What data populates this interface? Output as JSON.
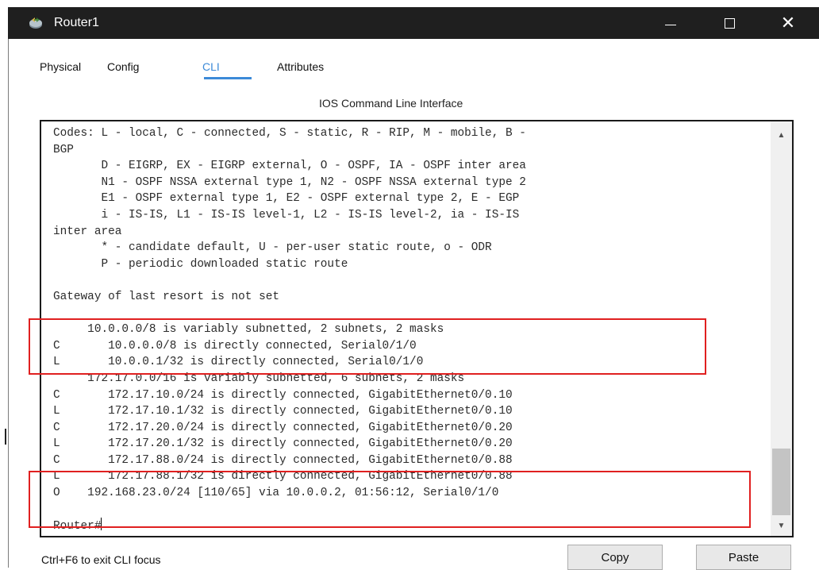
{
  "window": {
    "title": "Router1",
    "icon": "router-icon",
    "controls": {
      "minimize": "minimize-icon",
      "maximize": "maximize-icon",
      "close": "✕"
    }
  },
  "tabs": [
    {
      "label": "Physical",
      "active": false
    },
    {
      "label": "Config",
      "active": false
    },
    {
      "label": "CLI",
      "active": true
    },
    {
      "label": "Attributes",
      "active": false
    }
  ],
  "section_title": "IOS Command Line Interface",
  "terminal": {
    "lines": [
      "Codes: L - local, C - connected, S - static, R - RIP, M - mobile, B -",
      "BGP",
      "       D - EIGRP, EX - EIGRP external, O - OSPF, IA - OSPF inter area",
      "       N1 - OSPF NSSA external type 1, N2 - OSPF NSSA external type 2",
      "       E1 - OSPF external type 1, E2 - OSPF external type 2, E - EGP",
      "       i - IS-IS, L1 - IS-IS level-1, L2 - IS-IS level-2, ia - IS-IS",
      "inter area",
      "       * - candidate default, U - per-user static route, o - ODR",
      "       P - periodic downloaded static route",
      "",
      "Gateway of last resort is not set",
      "",
      "     10.0.0.0/8 is variably subnetted, 2 subnets, 2 masks",
      "C       10.0.0.0/8 is directly connected, Serial0/1/0",
      "L       10.0.0.1/32 is directly connected, Serial0/1/0",
      "     172.17.0.0/16 is variably subnetted, 6 subnets, 2 masks",
      "C       172.17.10.0/24 is directly connected, GigabitEthernet0/0.10",
      "L       172.17.10.1/32 is directly connected, GigabitEthernet0/0.10",
      "C       172.17.20.0/24 is directly connected, GigabitEthernet0/0.20",
      "L       172.17.20.1/32 is directly connected, GigabitEthernet0/0.20",
      "C       172.17.88.0/24 is directly connected, GigabitEthernet0/0.88",
      "L       172.17.88.1/32 is directly connected, GigabitEthernet0/0.88",
      "O    192.168.23.0/24 [110/65] via 10.0.0.2, 01:56:12, Serial0/1/0",
      ""
    ],
    "prompt": "Router#"
  },
  "footer": {
    "hint": "Ctrl+F6 to exit CLI focus",
    "copy_label": "Copy",
    "paste_label": "Paste"
  },
  "colors": {
    "accent": "#3c8ad8",
    "highlight_box": "#e02020",
    "titlebar": "#1f1f1f"
  }
}
